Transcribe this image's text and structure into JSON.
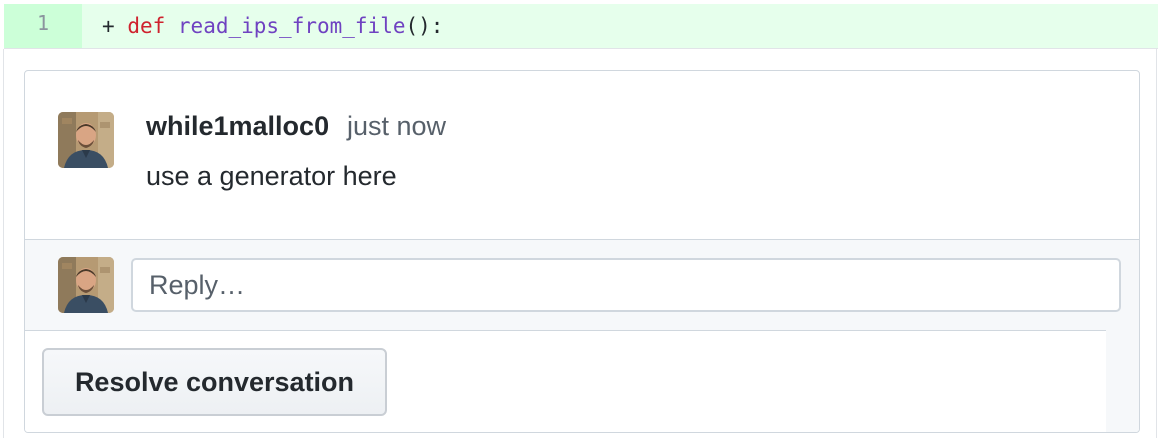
{
  "diff": {
    "line_number": "1",
    "marker": "+",
    "keyword": "def",
    "function_name": "read_ips_from_file",
    "suffix": "():"
  },
  "comment": {
    "author": "while1malloc0",
    "timestamp": "just now",
    "body": "use a generator here"
  },
  "reply": {
    "placeholder": "Reply…"
  },
  "actions": {
    "resolve_label": "Resolve conversation"
  },
  "icons": {
    "avatar": "user-avatar-photo"
  },
  "colors": {
    "added_line_bg": "#e6ffec",
    "keyword": "#cf222e",
    "function": "#6f42c1"
  }
}
